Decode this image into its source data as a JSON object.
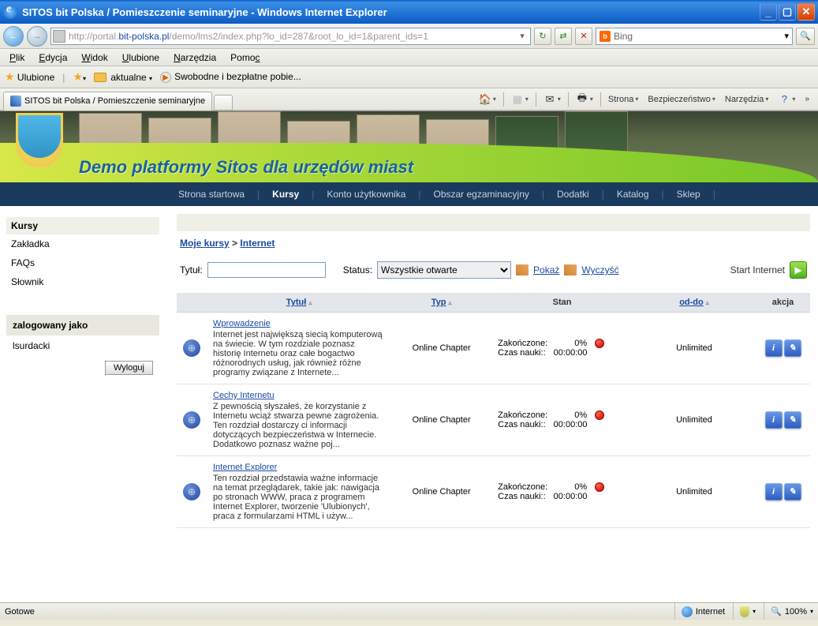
{
  "window": {
    "title": "SITOS bit Polska / Pomieszczenie seminaryjne - Windows Internet Explorer"
  },
  "address": {
    "protocol": "http://",
    "pre_host": "portal.",
    "host": "bit-polska.pl",
    "path": "/demo/lms2/index.php?lo_id=287&root_lo_id=1&parent_ids=1",
    "search_engine": "Bing"
  },
  "menu": {
    "file": "Plik",
    "edit": "Edycja",
    "view": "Widok",
    "favorites": "Ulubione",
    "tools": "Narzędzia",
    "help": "Pomoc"
  },
  "favbar": {
    "favorites": "Ulubione",
    "aktualne": "aktualne",
    "swobodne": "Swobodne i bezpłatne pobie..."
  },
  "tab": {
    "title": "SITOS bit Polska / Pomieszczenie seminaryjne"
  },
  "cmdbar": {
    "strona": "Strona",
    "bezp": "Bezpieczeństwo",
    "narz": "Narzędzia"
  },
  "banner": {
    "title": "Demo platformy Sitos dla urzędów miast"
  },
  "nav": {
    "strona": "Strona startowa",
    "kursy": "Kursy",
    "konto": "Konto użytkownika",
    "obszar": "Obszar egzaminacyjny",
    "dodatki": "Dodatki",
    "katalog": "Katalog",
    "sklep": "Sklep"
  },
  "sidebar": {
    "kursy": "Kursy",
    "zakladka": "Zakładka",
    "faqs": "FAQs",
    "slownik": "Słownik",
    "logged_as": "zalogowany jako",
    "user": "lsurdacki",
    "logout": "Wyloguj"
  },
  "bc": {
    "moje": "Moje kursy",
    "sep": ">",
    "internet": "Internet"
  },
  "filter": {
    "tytul_lbl": "Tytuł:",
    "status_lbl": "Status:",
    "status_value": "Wszystkie otwarte",
    "pokaz": "Pokaż",
    "wyczysc": "Wyczyść",
    "start": "Start Internet"
  },
  "thead": {
    "tytul": "Tytuł",
    "typ": "Typ",
    "stan": "Stan",
    "oddo": "od-do",
    "akcja": "akcja"
  },
  "rows": [
    {
      "title": "Wprowadzenie",
      "desc": "Internet jest największą siecią komputerową na świecie. W tym rozdziale poznasz historię Internetu oraz całe bogactwo różnorodnych usług, jak również różne programy związane z Internete...",
      "type": "Online Chapter",
      "zakonczone_lbl": "Zakończone:",
      "pct": "0%",
      "czas_lbl": "Czas nauki::",
      "czas": "00:00:00",
      "oddo": "Unlimited"
    },
    {
      "title": "Cechy Internetu",
      "desc": "Z pewnością słyszałeś, że korzystanie z Internetu wciąż stwarza pewne zagrożenia. Ten rozdział dostarczy ci informacji dotyczących bezpieczeństwa w Internecie. Dodatkowo poznasz ważne poj...",
      "type": "Online Chapter",
      "zakonczone_lbl": "Zakończone:",
      "pct": "0%",
      "czas_lbl": "Czas nauki::",
      "czas": "00:00:00",
      "oddo": "Unlimited"
    },
    {
      "title": "Internet Explorer",
      "desc": "Ten rozdział przedstawia ważne informacje na temat przeglądarek, takie jak: nawigacja po stronach WWW, praca z programem Internet Explorer, tworzenie 'Ulubionych', praca z formularzami HTML i używ...",
      "type": "Online Chapter",
      "zakonczone_lbl": "Zakończone:",
      "pct": "0%",
      "czas_lbl": "Czas nauki::",
      "czas": "00:00:00",
      "oddo": "Unlimited"
    }
  ],
  "status": {
    "gotowe": "Gotowe",
    "zone": "Internet",
    "zoom": "100%"
  }
}
